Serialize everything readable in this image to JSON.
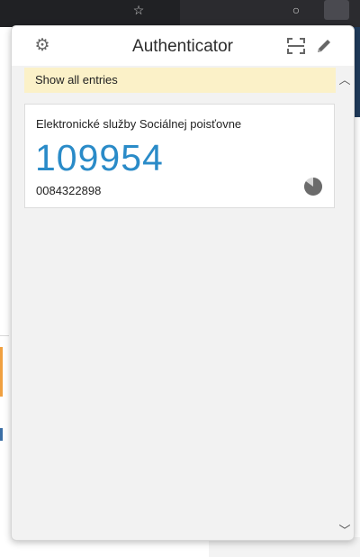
{
  "popup": {
    "title": "Authenticator",
    "notice": "Show all entries"
  },
  "entry": {
    "issuer": "Elektronické služby Sociálnej poisťovne",
    "code": "109954",
    "account": "0084322898",
    "timer_remaining_fraction": 0.85
  },
  "icons": {
    "settings": "gear-icon",
    "scan": "scan-qr-icon",
    "edit": "pencil-icon",
    "timer": "countdown-pie-icon",
    "scroll_up": "chevron-up-icon",
    "scroll_down": "chevron-down-icon"
  },
  "colors": {
    "code": "#2a8bc8",
    "notice_bg": "#fbf1c8",
    "timer": "#6b6b6b"
  }
}
